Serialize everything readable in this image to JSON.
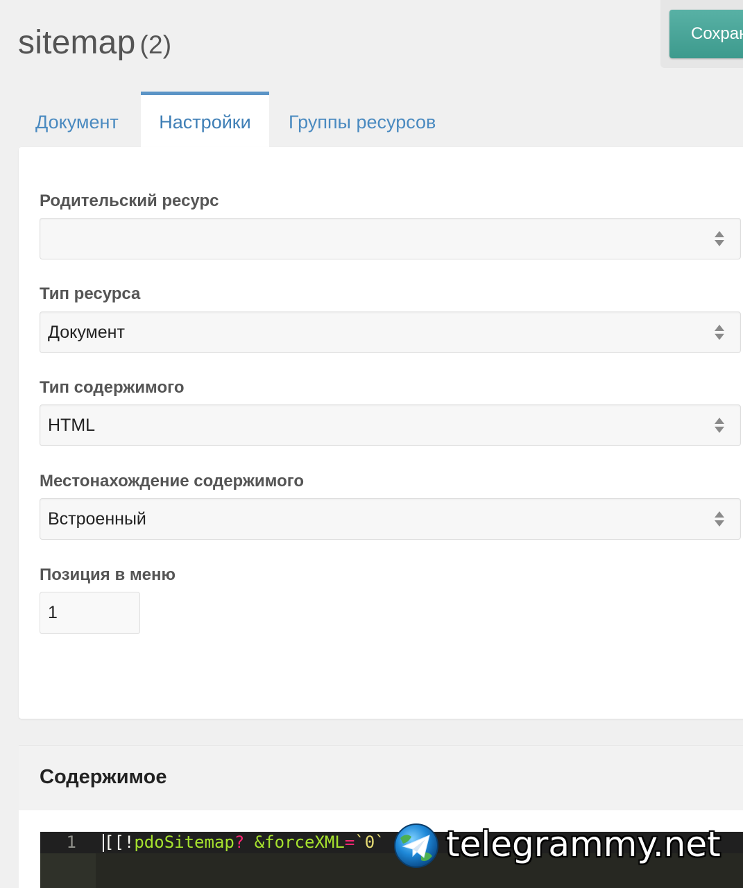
{
  "header": {
    "title": "sitemap",
    "count": "(2)",
    "save_label": "Сохранить"
  },
  "tabs": [
    {
      "label": "Документ",
      "active": false
    },
    {
      "label": "Настройки",
      "active": true
    },
    {
      "label": "Группы ресурсов",
      "active": false
    }
  ],
  "settings": {
    "parent": {
      "label": "Родительский ресурс",
      "value": ""
    },
    "resource_type": {
      "label": "Тип ресурса",
      "value": "Документ"
    },
    "content_type": {
      "label": "Тип содержимого",
      "value": "HTML"
    },
    "content_location": {
      "label": "Местонахождение содержимого",
      "value": "Встроенный"
    },
    "menu_position": {
      "label": "Позиция в меню",
      "value": "1"
    }
  },
  "content": {
    "heading": "Содержимое",
    "editor": {
      "line_number": "1",
      "tokens": {
        "open": "[[!",
        "snippet": "pdoSitemap",
        "question": "?",
        "space": " ",
        "param": "&forceXML",
        "equals": "=",
        "value": "`0`"
      }
    }
  },
  "watermark": {
    "text": "telegrammy.net",
    "icon": "telegram-globe-icon"
  },
  "colors": {
    "accent": "#4a8ac0",
    "save_button": "#3d9a8d",
    "active_tab_border": "#5b94c6",
    "editor_bg": "#272822"
  },
  "icons": {
    "select_arrows": "sort-arrows-icon"
  }
}
